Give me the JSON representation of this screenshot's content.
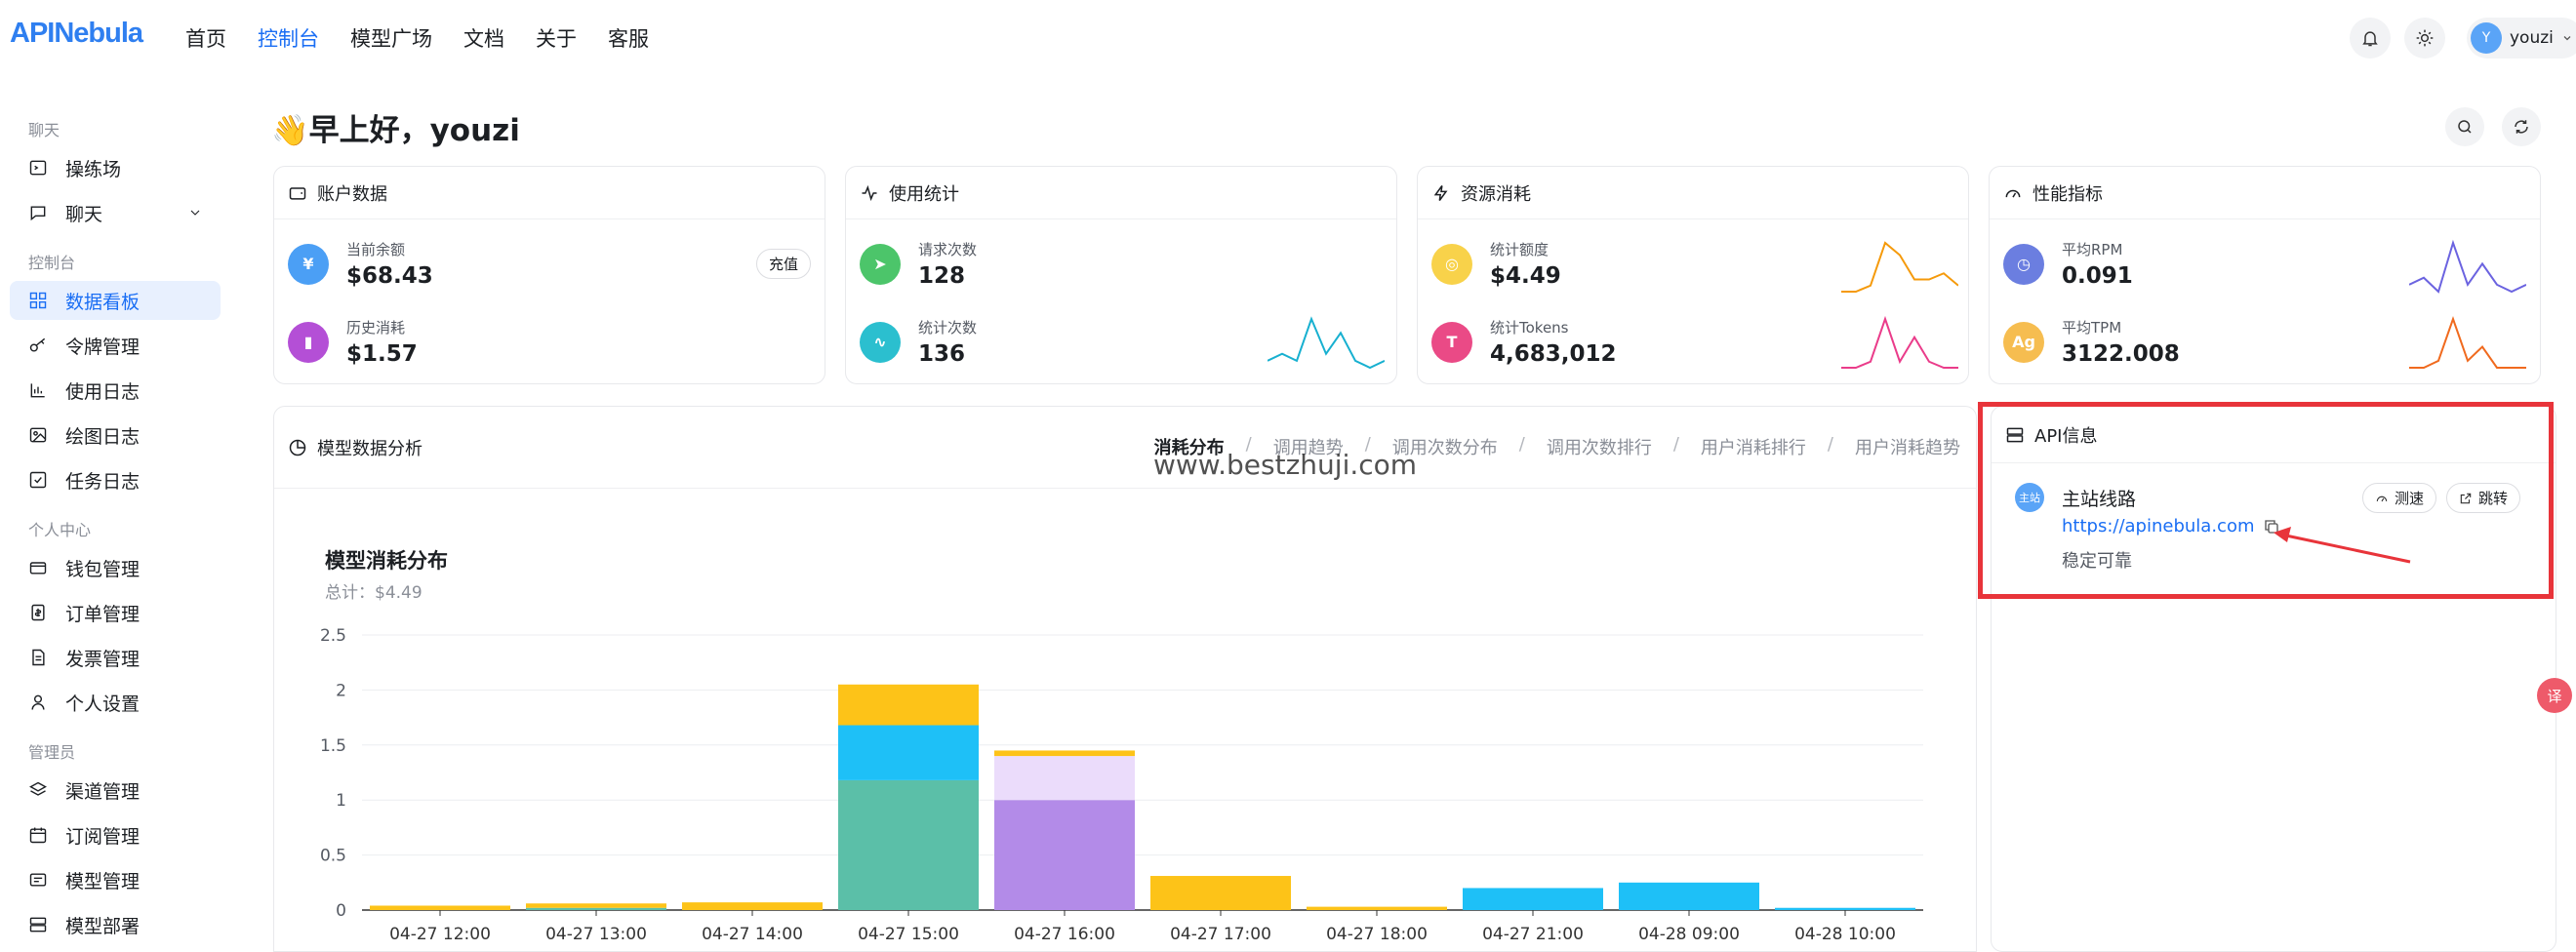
{
  "header": {
    "logo": "APINebula",
    "nav": [
      "首页",
      "控制台",
      "模型广场",
      "文档",
      "关于",
      "客服"
    ],
    "user": {
      "avatar_letter": "Y",
      "name": "youzi"
    }
  },
  "sidebar": {
    "groups": [
      {
        "label": "聊天",
        "items": [
          {
            "label": "操练场",
            "icon": "playground-icon"
          },
          {
            "label": "聊天",
            "icon": "chat-icon"
          }
        ]
      },
      {
        "label": "控制台",
        "items": [
          {
            "label": "数据看板",
            "icon": "dashboard-icon"
          },
          {
            "label": "令牌管理",
            "icon": "key-icon"
          },
          {
            "label": "使用日志",
            "icon": "bar-chart-icon"
          },
          {
            "label": "绘图日志",
            "icon": "image-icon"
          },
          {
            "label": "任务日志",
            "icon": "check-icon"
          }
        ]
      },
      {
        "label": "个人中心",
        "items": [
          {
            "label": "钱包管理",
            "icon": "wallet-icon"
          },
          {
            "label": "订单管理",
            "icon": "order-icon"
          },
          {
            "label": "发票管理",
            "icon": "invoice-icon"
          },
          {
            "label": "个人设置",
            "icon": "user-icon"
          }
        ]
      },
      {
        "label": "管理员",
        "items": [
          {
            "label": "渠道管理",
            "icon": "layers-icon"
          },
          {
            "label": "订阅管理",
            "icon": "calendar-icon"
          },
          {
            "label": "模型管理",
            "icon": "model-icon"
          },
          {
            "label": "模型部署",
            "icon": "deploy-icon"
          }
        ]
      }
    ]
  },
  "greeting": "👋早上好，youzi",
  "cards": {
    "account": {
      "title": "账户数据",
      "items": [
        {
          "label": "当前余额",
          "value": "$68.43"
        },
        {
          "label": "历史消耗",
          "value": "$1.57"
        }
      ],
      "recharge": "充值"
    },
    "usage": {
      "title": "使用统计",
      "items": [
        {
          "label": "请求次数",
          "value": "128"
        },
        {
          "label": "统计次数",
          "value": "136"
        }
      ]
    },
    "resource": {
      "title": "资源消耗",
      "items": [
        {
          "label": "统计额度",
          "value": "$4.49"
        },
        {
          "label": "统计Tokens",
          "value": "4,683,012"
        }
      ]
    },
    "perf": {
      "title": "性能指标",
      "items": [
        {
          "label": "平均RPM",
          "value": "0.091"
        },
        {
          "label": "平均TPM",
          "value": "3122.008"
        }
      ]
    }
  },
  "analysis": {
    "title": "模型数据分析",
    "tabs": [
      "消耗分布",
      "调用趋势",
      "调用次数分布",
      "调用次数排行",
      "用户消耗排行",
      "用户消耗趋势"
    ],
    "chart_title": "模型消耗分布",
    "chart_total": "总计：$4.49"
  },
  "chart_data": {
    "type": "bar",
    "stacked": true,
    "categories": [
      "04-27 12:00",
      "04-27 13:00",
      "04-27 14:00",
      "04-27 15:00",
      "04-27 16:00",
      "04-27 17:00",
      "04-27 18:00",
      "04-27 21:00",
      "04-28 09:00",
      "04-28 10:00"
    ],
    "series": [
      {
        "color": "#5bbfa8",
        "values": [
          0,
          0.02,
          0,
          1.18,
          0,
          0,
          0,
          0,
          0,
          0
        ]
      },
      {
        "color": "#b38be8",
        "values": [
          0,
          0,
          0,
          0,
          1.0,
          0,
          0,
          0,
          0,
          0
        ]
      },
      {
        "color": "#ebdcfb",
        "values": [
          0,
          0,
          0,
          0,
          0.4,
          0,
          0,
          0,
          0,
          0
        ]
      },
      {
        "color": "#1ec0f7",
        "values": [
          0,
          0,
          0,
          0.5,
          0,
          0,
          0,
          0.2,
          0.25,
          0.02
        ]
      },
      {
        "color": "#fdc318",
        "values": [
          0.04,
          0.04,
          0.07,
          0.37,
          0.05,
          0.31,
          0.03,
          0,
          0,
          0
        ]
      }
    ],
    "ylim": [
      0,
      2.5
    ],
    "yticks": [
      0,
      0.5,
      1,
      1.5,
      2,
      2.5
    ]
  },
  "sparklines": {
    "usage_count": {
      "color": "#17b0d0",
      "values": [
        2,
        3,
        2,
        8,
        3,
        6,
        2,
        1,
        2
      ]
    },
    "quota": {
      "color": "#f59a0b",
      "values": [
        1,
        1,
        2,
        9,
        7,
        3,
        3,
        4,
        2
      ]
    },
    "tokens": {
      "color": "#ea3c8a",
      "values": [
        1,
        1,
        2,
        9,
        2,
        6,
        2,
        1,
        1
      ]
    },
    "rpm": {
      "color": "#6b63e0",
      "values": [
        2,
        3,
        1,
        8,
        2,
        5,
        2,
        1,
        2
      ]
    },
    "tpm": {
      "color": "#f06a1e",
      "values": [
        1,
        1,
        2,
        8,
        2,
        4,
        1,
        1,
        1
      ]
    }
  },
  "api_info": {
    "title": "API信息",
    "route": {
      "badge": "主站",
      "name": "主站线路",
      "url": "https://apinebula.com",
      "note": "稳定可靠"
    },
    "speedtest": "测速",
    "jump": "跳转"
  },
  "watermark": "www.bestzhuji.com",
  "float_button": "译"
}
